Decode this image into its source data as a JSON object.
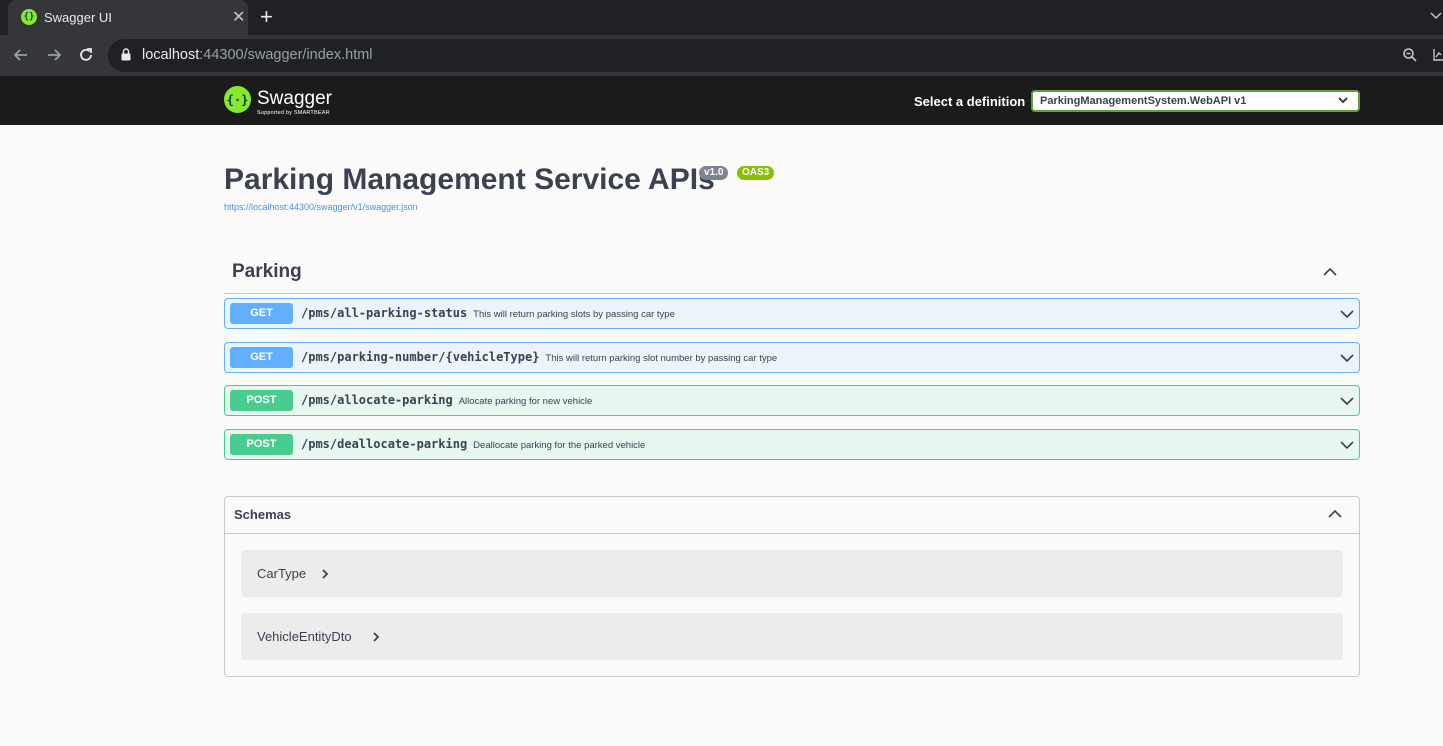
{
  "browser": {
    "tab_title": "Swagger UI",
    "tab_close": "✕",
    "new_tab": "+",
    "url_host": "localhost",
    "url_rest": ":44300/swagger/index.html"
  },
  "topbar": {
    "logo_text": "Swagger",
    "logo_sub": "Supported by SMARTBEAR",
    "definition_label": "Select a definition",
    "definition_value": "ParkingManagementSystem.WebAPI v1"
  },
  "info": {
    "title": "Parking Management Service APIs",
    "version": "v1.0",
    "oas": "OAS3",
    "spec_link": "https://localhost:44300/swagger/v1/swagger.json"
  },
  "tag": {
    "name": "Parking",
    "operations": [
      {
        "method": "GET",
        "path": "/pms/all-parking-status",
        "summary": "This will return parking slots by passing car type"
      },
      {
        "method": "GET",
        "path": "/pms/parking-number/{vehicleType}",
        "summary": "This will return parking slot number by passing car type"
      },
      {
        "method": "POST",
        "path": "/pms/allocate-parking",
        "summary": "Allocate parking for new vehicle"
      },
      {
        "method": "POST",
        "path": "/pms/deallocate-parking",
        "summary": "Deallocate parking for the parked vehicle"
      }
    ]
  },
  "schemas": {
    "title": "Schemas",
    "models": [
      "CarType",
      "VehicleEntityDto"
    ]
  },
  "colors": {
    "get": "#61affe",
    "post": "#49cc90",
    "swagger_green": "#85ea2d",
    "topbar": "#1b1b1b"
  }
}
